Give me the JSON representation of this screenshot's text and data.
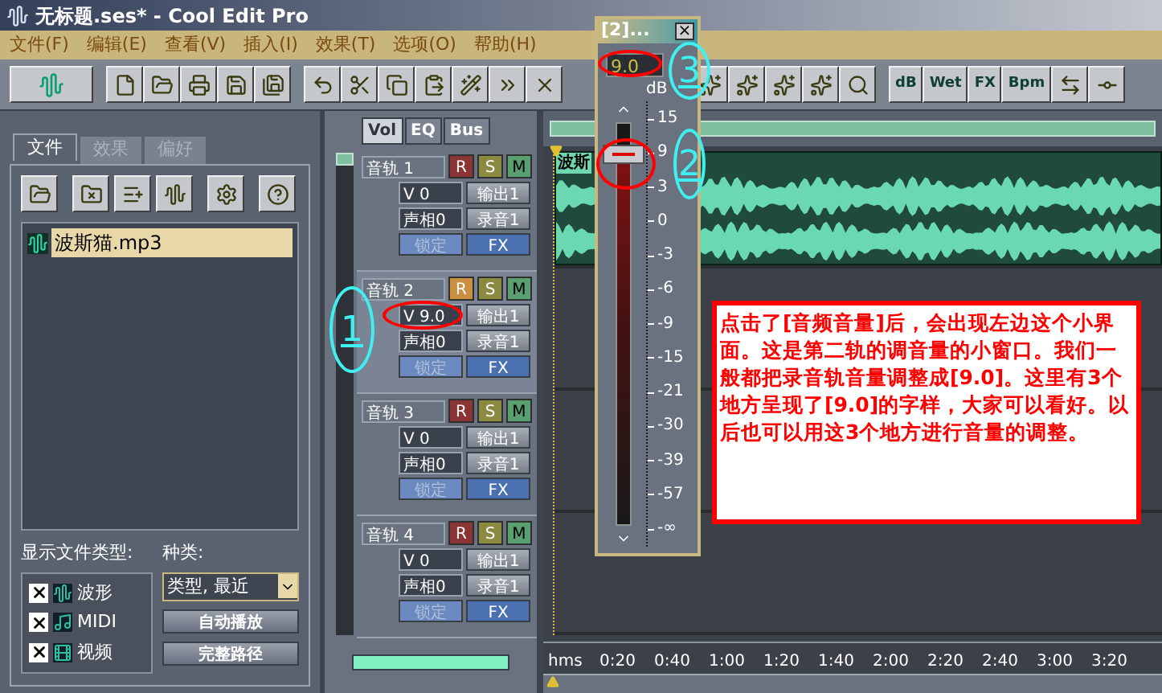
{
  "window": {
    "title": "无标题.ses* - Cool Edit Pro"
  },
  "menu": [
    {
      "label": "文件(F)"
    },
    {
      "label": "编辑(E)"
    },
    {
      "label": "查看(V)"
    },
    {
      "label": "插入(I)"
    },
    {
      "label": "效果(T)"
    },
    {
      "label": "选项(O)"
    },
    {
      "label": "帮助(H)"
    }
  ],
  "toolbar": {
    "labeled_buttons": [
      {
        "label": "dB"
      },
      {
        "label": "Wet"
      },
      {
        "label": "FX"
      },
      {
        "label": "Bpm"
      }
    ]
  },
  "file_panel": {
    "tabs": [
      {
        "label": "文件",
        "selected": true
      },
      {
        "label": "效果",
        "selected": false
      },
      {
        "label": "偏好",
        "selected": false
      }
    ],
    "files": [
      {
        "name": "波斯猫.mp3",
        "selected": true
      }
    ],
    "show_types_label": "显示文件类型:",
    "types": [
      {
        "label": "波形",
        "checked": true
      },
      {
        "label": "MIDI",
        "checked": true
      },
      {
        "label": "视频",
        "checked": true
      }
    ],
    "sort_label": "种类:",
    "sort_value": "类型, 最近",
    "buttons": [
      {
        "label": "自动播放"
      },
      {
        "label": "完整路径"
      }
    ]
  },
  "mixer": {
    "tabs": [
      {
        "label": "Vol",
        "selected": true
      },
      {
        "label": "EQ",
        "selected": false
      },
      {
        "label": "Bus",
        "selected": false
      }
    ],
    "tracks": [
      {
        "name": "音轨 1",
        "selected": false,
        "record_armed": false,
        "rec": "R",
        "solo": "S",
        "mute": "M",
        "volume": "V 0",
        "output": "输出1",
        "pan": "声相0",
        "record": "录音1",
        "lock": "锁定",
        "fx": "FX"
      },
      {
        "name": "音轨 2",
        "selected": true,
        "record_armed": true,
        "rec": "R",
        "solo": "S",
        "mute": "M",
        "volume": "V 9.0",
        "output": "输出1",
        "pan": "声相0",
        "record": "录音1",
        "lock": "锁定",
        "fx": "FX"
      },
      {
        "name": "音轨 3",
        "selected": false,
        "record_armed": false,
        "rec": "R",
        "solo": "S",
        "mute": "M",
        "volume": "V 0",
        "output": "输出1",
        "pan": "声相0",
        "record": "录音1",
        "lock": "锁定",
        "fx": "FX"
      },
      {
        "name": "音轨 4",
        "selected": false,
        "record_armed": false,
        "rec": "R",
        "solo": "S",
        "mute": "M",
        "volume": "V 0",
        "output": "输出1",
        "pan": "声相0",
        "record": "录音1",
        "lock": "锁定",
        "fx": "FX"
      }
    ]
  },
  "arrange": {
    "clip": {
      "label": "波斯"
    },
    "ruler": {
      "unit": "hms",
      "ticks": [
        "0:20",
        "0:40",
        "1:00",
        "1:20",
        "1:40",
        "2:00",
        "2:20",
        "2:40",
        "3:00",
        "3:20"
      ]
    }
  },
  "volume_popup": {
    "title": "[2]...",
    "close": "×",
    "value": "9.0",
    "unit": "dB",
    "scale": [
      "15",
      "9",
      "3",
      "0",
      "-3",
      "-6",
      "-9",
      "-15",
      "-21",
      "-30",
      "-39",
      "-57",
      "-∞"
    ],
    "level": 0.92
  },
  "annotations": {
    "note": "点击了[音频音量]后，会出现左边这个小界面。这是第二轨的调音量的小窗口。我们一般都把录音轨音量调整成[9.0]。这里有3个地方呈现了[9.0]的字样，大家可以看好。以后也可以用这3个地方进行音量的调整。",
    "markers": [
      {
        "label": "1"
      },
      {
        "label": "2"
      },
      {
        "label": "3"
      }
    ]
  }
}
